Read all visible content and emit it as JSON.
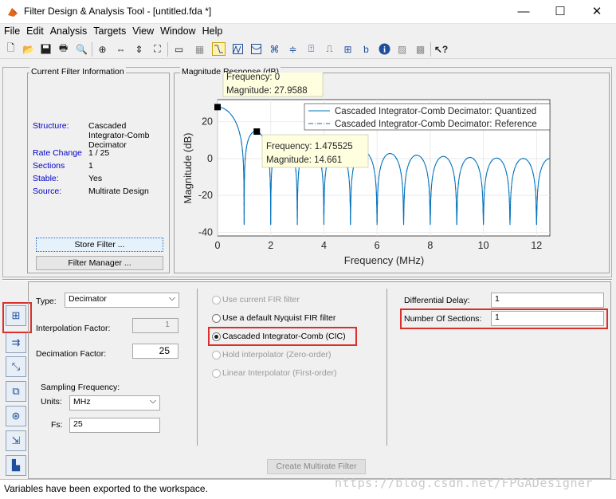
{
  "window": {
    "title": "Filter Design & Analysis Tool -  [untitled.fda *]",
    "minimize": "—",
    "maximize": "☐",
    "close": "✕"
  },
  "menu": [
    "File",
    "Edit",
    "Analysis",
    "Targets",
    "View",
    "Window",
    "Help"
  ],
  "toolbar_icons": [
    "new-icon",
    "open-icon",
    "save-icon",
    "print-icon",
    "print-preview-icon",
    "zoom-in-icon",
    "zoom-x-icon",
    "zoom-y-icon",
    "full-view-icon",
    "new-figure-icon",
    "filter-specs-icon",
    "magnitude-response-icon",
    "phase-response-icon",
    "magnitude-phase-icon",
    "group-delay-icon",
    "phase-delay-icon",
    "impulse-response-icon",
    "step-response-icon",
    "pole-zero-icon",
    "coefficients-icon",
    "info-icon",
    "magnitude-estimate-icon",
    "noise-power-icon",
    "whats-this-icon"
  ],
  "current_filter": {
    "title": "Current Filter Information",
    "rows": [
      {
        "label": "Structure:",
        "value": "Cascaded Integrator-Comb Decimator"
      },
      {
        "label": "Rate Change",
        "value": "1 / 25"
      },
      {
        "label": "Sections",
        "value": "1"
      },
      {
        "label": "Stable:",
        "value": "Yes"
      },
      {
        "label": "Source:",
        "value": "Multirate Design"
      }
    ],
    "store_button": "Store Filter ...",
    "manager_button": "Filter Manager ..."
  },
  "plot": {
    "title": "Magnitude Response (dB)",
    "tooltip1": {
      "line1": "Frequency: 0",
      "line2": "Magnitude: 27.9588"
    },
    "tooltip2": {
      "line1": "Frequency: 1.475525",
      "line2": "Magnitude: 14.661"
    }
  },
  "chart_data": {
    "type": "line",
    "xlabel": "Frequency (MHz)",
    "ylabel": "Magnitude (dB)",
    "xlim": [
      0,
      12.5
    ],
    "ylim": [
      -42,
      32
    ],
    "xticks": [
      "0",
      "2",
      "4",
      "6",
      "8",
      "10",
      "12"
    ],
    "yticks": [
      "20",
      "0",
      "-20",
      "-40"
    ],
    "series": [
      {
        "name": "Cascaded Integrator-Comb Decimator: Quantized",
        "style": "solid",
        "color": "#0072bd"
      },
      {
        "name": "Cascaded Integrator-Comb Decimator: Reference",
        "style": "dashdot",
        "color": "#0072bd"
      }
    ],
    "datatips": [
      {
        "x": 0,
        "y": 27.9588
      },
      {
        "x": 1.475525,
        "y": 14.661
      }
    ],
    "nulls_every": 1.0,
    "peak_db": 27.9588
  },
  "multirate": {
    "type_label": "Type:",
    "type_value": "Decimator",
    "interp_label": "Interpolation Factor:",
    "interp_value": "1",
    "decim_label": "Decimation Factor:",
    "decim_value": "25",
    "fs_group": "Sampling Frequency:",
    "units_label": "Units:",
    "units_value": "MHz",
    "fs_label": "Fs:",
    "fs_value": "25",
    "options": [
      {
        "label": "Use current FIR filter",
        "enabled": false
      },
      {
        "label": "Use a default Nyquist FIR filter",
        "enabled": true
      },
      {
        "label": "Cascaded Integrator-Comb (CIC)",
        "enabled": true
      },
      {
        "label": "Hold interpolator (Zero-order)",
        "enabled": false
      },
      {
        "label": "Linear Interpolator (First-order)",
        "enabled": false
      }
    ],
    "diff_delay_label": "Differential Delay:",
    "diff_delay_value": "1",
    "sections_label": "Number Of Sections:",
    "sections_value": "1",
    "create_button": "Create Multirate Filter"
  },
  "status": {
    "text": "Variables have been exported to the workspace.",
    "watermark": "https://blog.csdn.net/FPGADesigner"
  }
}
